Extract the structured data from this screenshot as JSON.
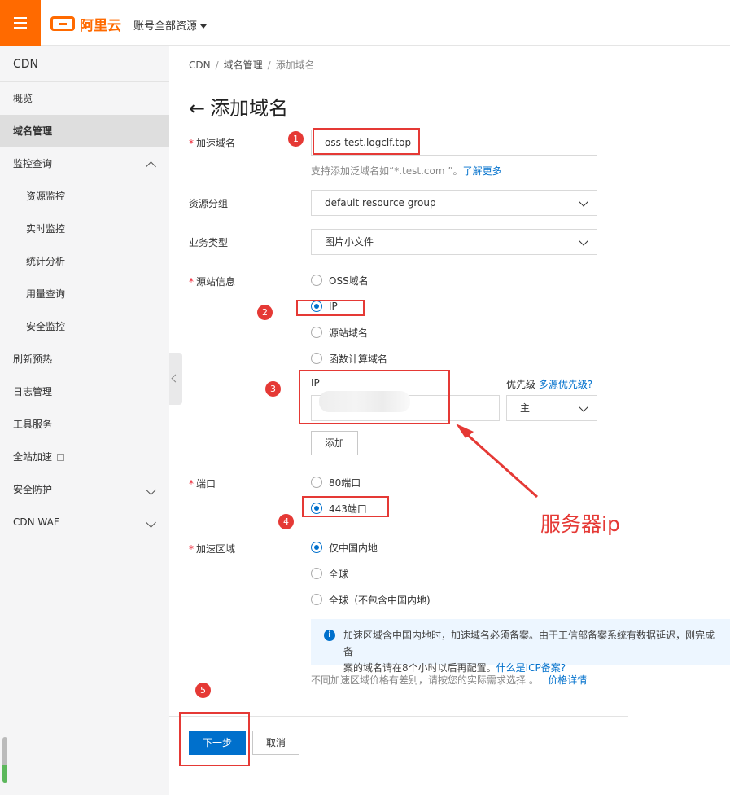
{
  "header": {
    "logo_text": "阿里云",
    "account_label": "账号全部资源"
  },
  "sidebar": {
    "title": "CDN",
    "items": [
      "概览",
      "域名管理",
      "监控查询",
      "资源监控",
      "实时监控",
      "统计分析",
      "用量查询",
      "安全监控",
      "刷新预热",
      "日志管理",
      "工具服务",
      "全站加速",
      "安全防护",
      "CDN WAF"
    ]
  },
  "breadcrumb": [
    "CDN",
    "域名管理",
    "添加域名"
  ],
  "page": {
    "title": "添加域名"
  },
  "form": {
    "domain": {
      "label": "加速域名",
      "value": "oss-test.logclf.top",
      "hint": "支持添加泛域名如“*.test.com ”。",
      "hint_link": "了解更多"
    },
    "group": {
      "label": "资源分组",
      "value": "default resource group"
    },
    "biz_type": {
      "label": "业务类型",
      "value": "图片小文件"
    },
    "origin": {
      "label": "源站信息",
      "options": [
        "OSS域名",
        "IP",
        "源站域名",
        "函数计算域名"
      ],
      "selected": "IP",
      "ip_label": "IP",
      "priority_label": "优先级",
      "priority_link": "多源优先级?",
      "priority_value": "主",
      "add_button": "添加"
    },
    "port": {
      "label": "端口",
      "options": [
        "80端口",
        "443端口"
      ],
      "selected": "443端口"
    },
    "region": {
      "label": "加速区域",
      "options": [
        "仅中国内地",
        "全球",
        "全球（不包含中国内地)"
      ],
      "selected": "仅中国内地",
      "notice_line1": "加速区域含中国内地时，加速域名必须备案。由于工信部备案系统有数据延迟，刚完成备",
      "notice_line2": "案的域名请在8个小时以后再配置。",
      "notice_link": "什么是ICP备案?",
      "price_hint": "不同加速区域价格有差别，请按您的实际需求选择 。",
      "price_link": "价格详情"
    }
  },
  "footer": {
    "next_button": "下一步",
    "cancel_button": "取消"
  },
  "annotations": {
    "numbers": [
      "1",
      "2",
      "3",
      "4",
      "5"
    ],
    "caption": "服务器ip"
  },
  "colors": {
    "brand": "#ff6a00",
    "primary": "#0070cc",
    "annotation": "#e53935"
  }
}
